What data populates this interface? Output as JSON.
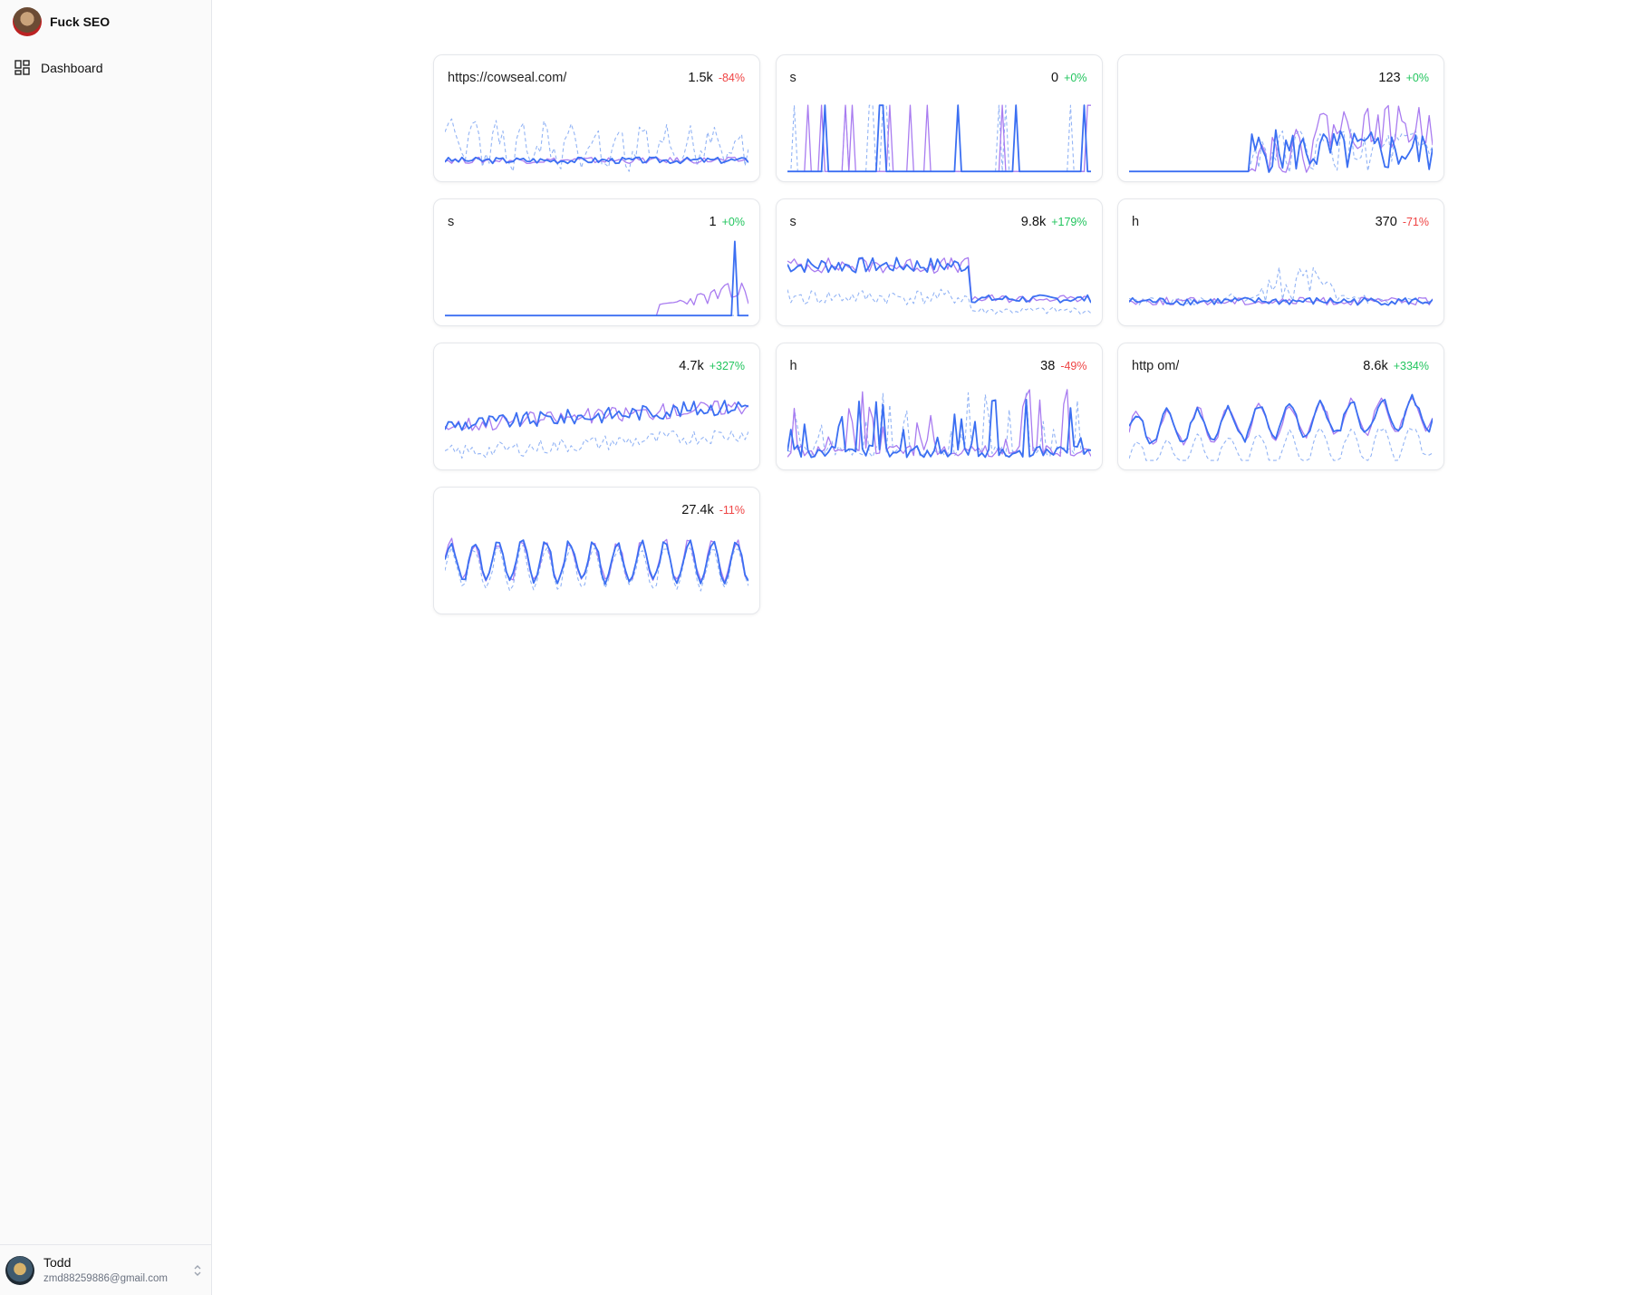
{
  "app": {
    "title": "Fuck SEO"
  },
  "sidebar": {
    "items": [
      {
        "label": "Dashboard",
        "icon": "dashboard-icon"
      }
    ]
  },
  "user": {
    "name": "Todd",
    "email": "zmd88259886@gmail.com"
  },
  "colors": {
    "accent": "#3b6ff2",
    "secondary": "#a97cf0",
    "dashed": "#93b4f5",
    "positive": "#22c55e",
    "negative": "#ef4444"
  },
  "sites": [
    {
      "url": "https://cowseal.com/",
      "value": "1.5k",
      "change": "-84%",
      "trend": "neg",
      "shape": "flat"
    },
    {
      "url": "s",
      "value": "0",
      "change": "+0%",
      "trend": "pos",
      "shape": "spikes"
    },
    {
      "url": "",
      "value": "123",
      "change": "+0%",
      "trend": "pos",
      "shape": "late"
    },
    {
      "url": "s",
      "value": "1",
      "change": "+0%",
      "trend": "pos",
      "shape": "single-spike"
    },
    {
      "url": "s",
      "value": "9.8k",
      "change": "+179%",
      "trend": "pos",
      "shape": "drop"
    },
    {
      "url": "h",
      "value": "370",
      "change": "-71%",
      "trend": "neg",
      "shape": "mid-bump"
    },
    {
      "url": "",
      "value": "4.7k",
      "change": "+327%",
      "trend": "pos",
      "shape": "rising"
    },
    {
      "url": "h",
      "value": "38",
      "change": "-49%",
      "trend": "neg",
      "shape": "noisy"
    },
    {
      "url": "http                                        om/",
      "value": "8.6k",
      "change": "+334%",
      "trend": "pos",
      "shape": "waves"
    },
    {
      "url": "",
      "value": "27.4k",
      "change": "-11%",
      "trend": "neg",
      "shape": "weekly"
    }
  ]
}
